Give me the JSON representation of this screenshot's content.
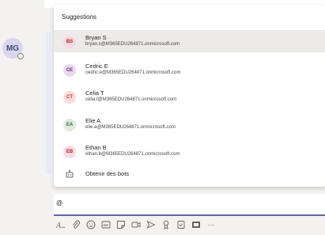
{
  "chat": {
    "avatar_initials": "MG"
  },
  "suggestions": {
    "title": "Suggestions",
    "items": [
      {
        "initials": "BS",
        "name": "Bryan S",
        "email": "bryan.s@M365EDU264871.onmicrosoft.com",
        "avatar_bg": "#f7d7df",
        "avatar_fg": "#a4262c",
        "selected": true
      },
      {
        "initials": "CE",
        "name": "Cedric E",
        "email": "cedric.e@M365EDU264871.onmicrosoft.com",
        "avatar_bg": "#e9d9ef",
        "avatar_fg": "#6b2d7a",
        "selected": false
      },
      {
        "initials": "CT",
        "name": "Celia T",
        "email": "celia.t@M365EDU264871.onmicrosoft.com",
        "avatar_bg": "#fbdcd8",
        "avatar_fg": "#b83d2b",
        "selected": false
      },
      {
        "initials": "EA",
        "name": "Elie A",
        "email": "elie.a@M365EDU264871.onmicrosoft.com",
        "avatar_bg": "#dfe9df",
        "avatar_fg": "#3d6b3d",
        "selected": false
      },
      {
        "initials": "EB",
        "name": "Ethan B",
        "email": "ethan.b@M365EDU264871.onmicrosoft.com",
        "avatar_bg": "#f8dadf",
        "avatar_fg": "#a4262c",
        "selected": false
      }
    ],
    "bots_label": "Obtenir des bots"
  },
  "compose": {
    "value": "@"
  },
  "toolbar": {
    "icons": [
      "format-icon",
      "attach-icon",
      "emoji-icon",
      "gif-icon",
      "sticker-icon",
      "meet-now-icon",
      "deliver-icon",
      "praise-icon",
      "approvals-icon",
      "stream-icon",
      "more-options-icon"
    ],
    "more_label": "···"
  }
}
